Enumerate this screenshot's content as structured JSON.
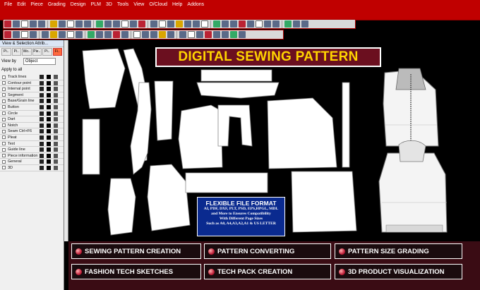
{
  "menu": [
    "File",
    "Edit",
    "Piece",
    "Grading",
    "Design",
    "PLM",
    "3D",
    "Tools",
    "View",
    "O/Cloud",
    "Help",
    "Addons"
  ],
  "panel": {
    "title": "View & Selection Attrib...",
    "tabs": [
      "Pi..",
      "Pi..",
      "Wo..",
      "Pie..",
      "Pi..",
      "Fi.."
    ],
    "view_by_label": "View by",
    "view_by_value": "Object",
    "apply_all": "Apply to all",
    "rows": [
      "Track lines",
      "Contour point",
      "Internal point",
      "Segment",
      "Base/Grain line",
      "Button",
      "Circle",
      "Dart",
      "Notch",
      "Seam   Ctrl+F6",
      "Pleat",
      "Text",
      "Guide line",
      "Piece information",
      "General",
      "3D"
    ]
  },
  "banner": {
    "title": "DIGITAL SEWING PATTERN"
  },
  "info": {
    "heading": "FLEXIBLE FILE FORMAT",
    "lines": [
      "AI, PDF, DXF, PLT, PSD, EPS,HPGL, MDL",
      "and More to Ensures Compatibility",
      "With Different Page Sizes",
      "Such as A0, A4,A3,A2,A1 & US LETTER"
    ]
  },
  "services": [
    "SEWING PATTERN CREATION",
    "PATTERN CONVERTING",
    "PATTERN SIZE GRADING",
    "FASHION TECH SKETCHES",
    "TECH PACK CREATION",
    "3D PRODUCT VISUALIZATION"
  ],
  "colors": {
    "menubar": "#c00000",
    "banner_bg": "#6b0f1f",
    "banner_text": "#ffd400",
    "info_bg": "#0a2a8f",
    "service_bg": "#3a0c14"
  }
}
